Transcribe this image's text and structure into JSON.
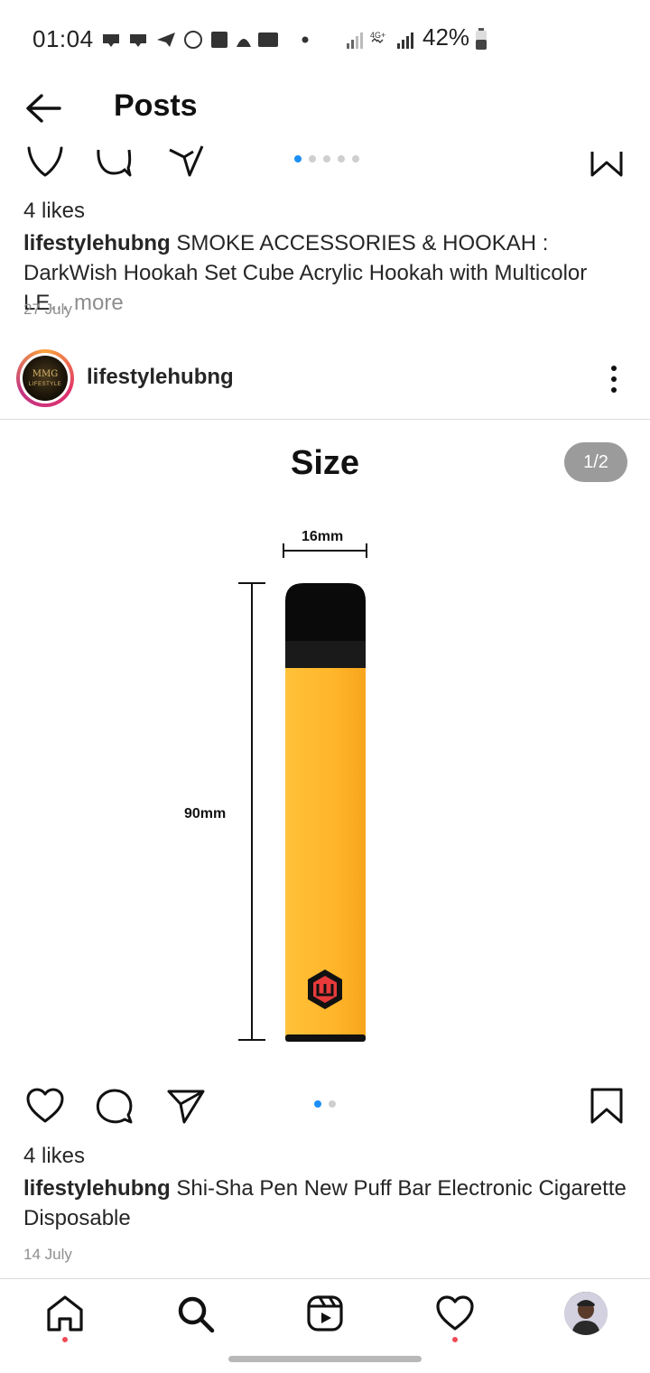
{
  "status_bar": {
    "time": "01:04",
    "battery": "42%",
    "network": "4G+"
  },
  "header": {
    "title": "Posts"
  },
  "previous_post": {
    "likes": "4 likes",
    "username": "lifestylehubng",
    "caption": "SMOKE ACCESSORIES & HOOKAH : DarkWish Hookah Set Cube Acrylic Hookah with Multicolor LE",
    "ellipsis": "...",
    "more_label": "more",
    "date": "27 July"
  },
  "post": {
    "username": "lifestylehubng",
    "avatar_text_top": "MMG",
    "avatar_text_bottom": "LIFESTYLE",
    "image": {
      "title": "Size",
      "counter": "1/2",
      "width_label": "16mm",
      "height_label": "90mm",
      "body_color": "#ffb52a",
      "cap_color": "#0a0a0a"
    },
    "likes": "4 likes",
    "caption": "Shi-Sha Pen New Puff Bar Electronic Cigarette Disposable",
    "date": "14 July"
  },
  "bottom_nav": {
    "items": [
      "home-icon",
      "search-icon",
      "reels-icon",
      "activity-heart-icon",
      "profile-avatar"
    ]
  },
  "colors": {
    "accent": "#1c8ef5",
    "notification": "#ed4956",
    "muted": "#8e8e8e"
  }
}
